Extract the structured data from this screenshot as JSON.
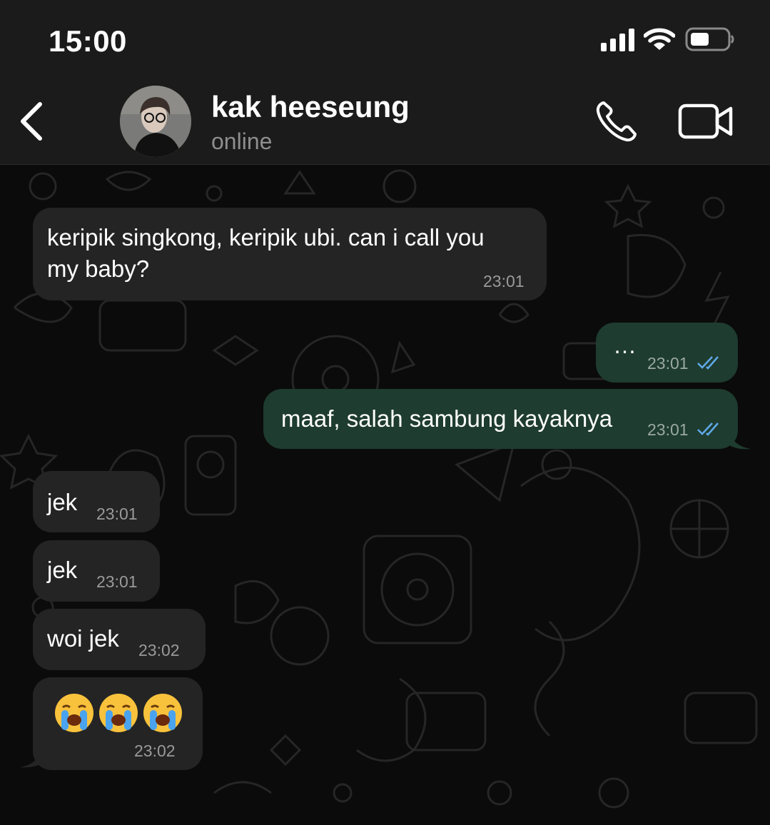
{
  "status_bar": {
    "time": "15:00",
    "signal_icon": "cellular-signal-icon",
    "wifi_icon": "wifi-icon",
    "battery_icon": "battery-icon",
    "battery_level": 0.45
  },
  "header": {
    "back_icon": "chevron-left-icon",
    "contact_name": "kak heeseung",
    "contact_status": "online",
    "call_icon": "phone-icon",
    "video_icon": "video-camera-icon"
  },
  "colors": {
    "header_bg": "#1b1b1b",
    "chat_bg": "#0b0b0b",
    "incoming_bubble": "#242424",
    "outgoing_bubble": "#1e3c2f",
    "read_ticks": "#5fa7e6",
    "secondary_text": "#8e8e8e"
  },
  "messages": [
    {
      "direction": "incoming",
      "lines": [
        "keripik singkong, keripik ubi. can i call you",
        "my baby?"
      ],
      "time": "23:01"
    },
    {
      "direction": "outgoing",
      "text": "…",
      "time": "23:01",
      "status": "read"
    },
    {
      "direction": "outgoing",
      "text": "maaf, salah sambung kayaknya",
      "time": "23:01",
      "status": "read"
    },
    {
      "direction": "incoming",
      "text": "jek",
      "time": "23:01"
    },
    {
      "direction": "incoming",
      "text": "jek",
      "time": "23:01"
    },
    {
      "direction": "incoming",
      "text": "woi jek",
      "time": "23:02"
    },
    {
      "direction": "incoming",
      "emojis": [
        "loudly-crying-face",
        "loudly-crying-face",
        "loudly-crying-face"
      ],
      "time": "23:02"
    }
  ]
}
